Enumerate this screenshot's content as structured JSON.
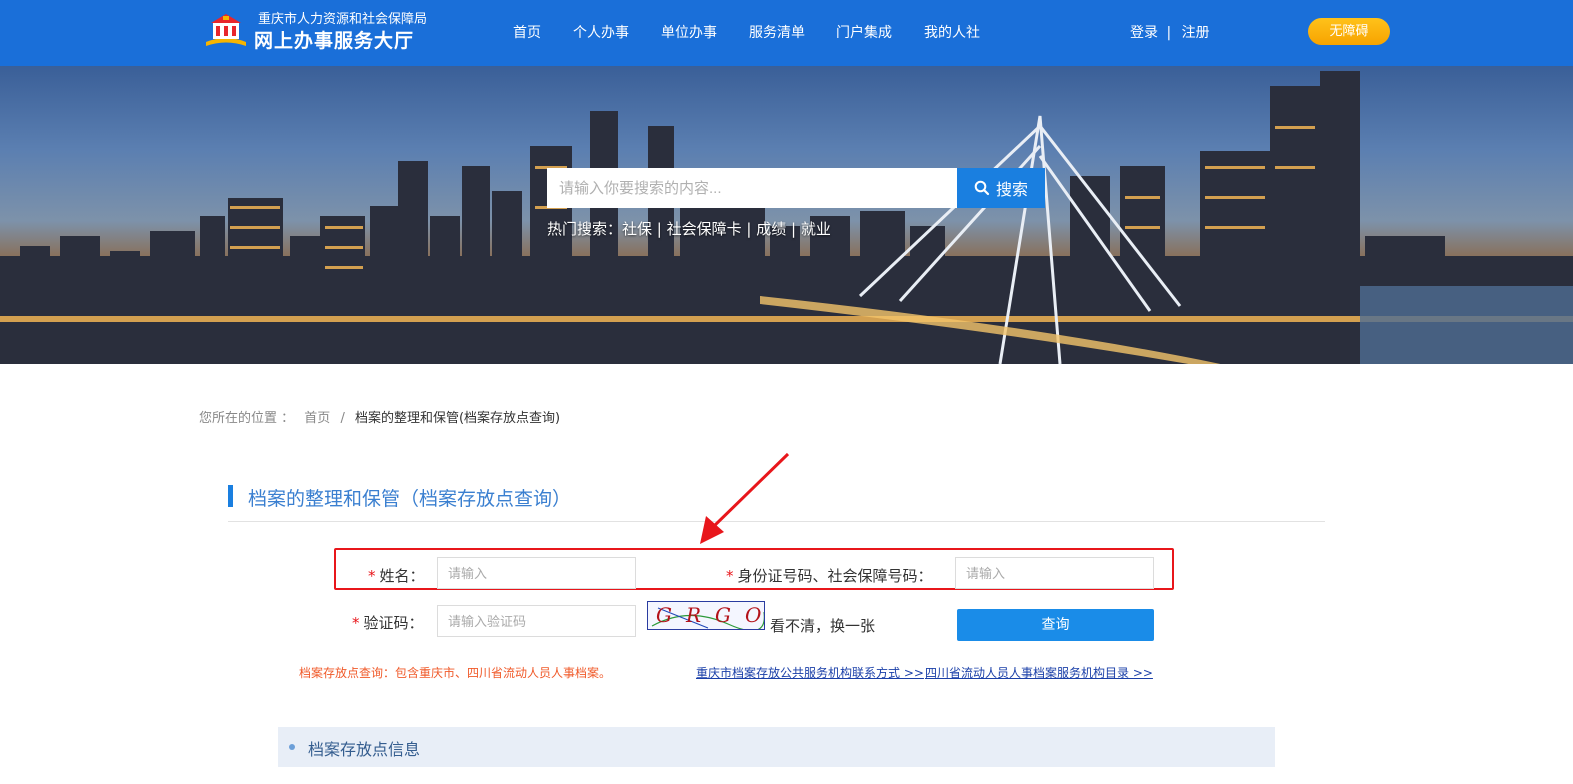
{
  "header": {
    "org_name": "重庆市人力资源和社会保障局",
    "hall_name": "网上办事服务大厅",
    "nav": [
      "首页",
      "个人办事",
      "单位办事",
      "服务清单",
      "门户集成",
      "我的人社"
    ],
    "login": "登录",
    "separator": "|",
    "register": "注册",
    "accessibility": "无障碍"
  },
  "search": {
    "placeholder": "请输入你要搜索的内容...",
    "button": "搜索",
    "hot_label": "热门搜索：",
    "hot_keywords": [
      "社保",
      "社会保障卡",
      "成绩",
      "就业"
    ],
    "divider": " | "
  },
  "breadcrumb": {
    "prefix": "您所在的位置 ：",
    "home": "首页",
    "sep": "/",
    "current": "档案的整理和保管(档案存放点查询)"
  },
  "section": {
    "title": "档案的整理和保管（档案存放点查询）"
  },
  "form": {
    "required_mark": "*",
    "name_label": "姓名：",
    "name_placeholder": "请输入",
    "id_label": "身份证号码、社会保障号码：",
    "id_placeholder": "请输入",
    "captcha_label": "验证码：",
    "captcha_placeholder": "请输入验证码",
    "captcha_text": "GRGO",
    "refresh": "看不清，换一张",
    "query": "查询"
  },
  "notes": {
    "scope": "档案存放点查询：包含重庆市、四川省流动人员人事档案。",
    "link1": "重庆市档案存放公共服务机构联系方式 >>",
    "link2": "四川省流动人员人事档案服务机构目录 >>"
  },
  "results": {
    "title": "档案存放点信息"
  },
  "colors": {
    "header_bg": "#1a6fd9",
    "accent": "#1a7fe0",
    "required": "#e8161b",
    "highlight_box": "#e8161b",
    "note": "#f05a2a",
    "accessibility_btn": "#f7a300"
  },
  "icons": {
    "logo": "building-logo-icon",
    "search": "search-icon",
    "annotation": "red-arrow-icon"
  }
}
